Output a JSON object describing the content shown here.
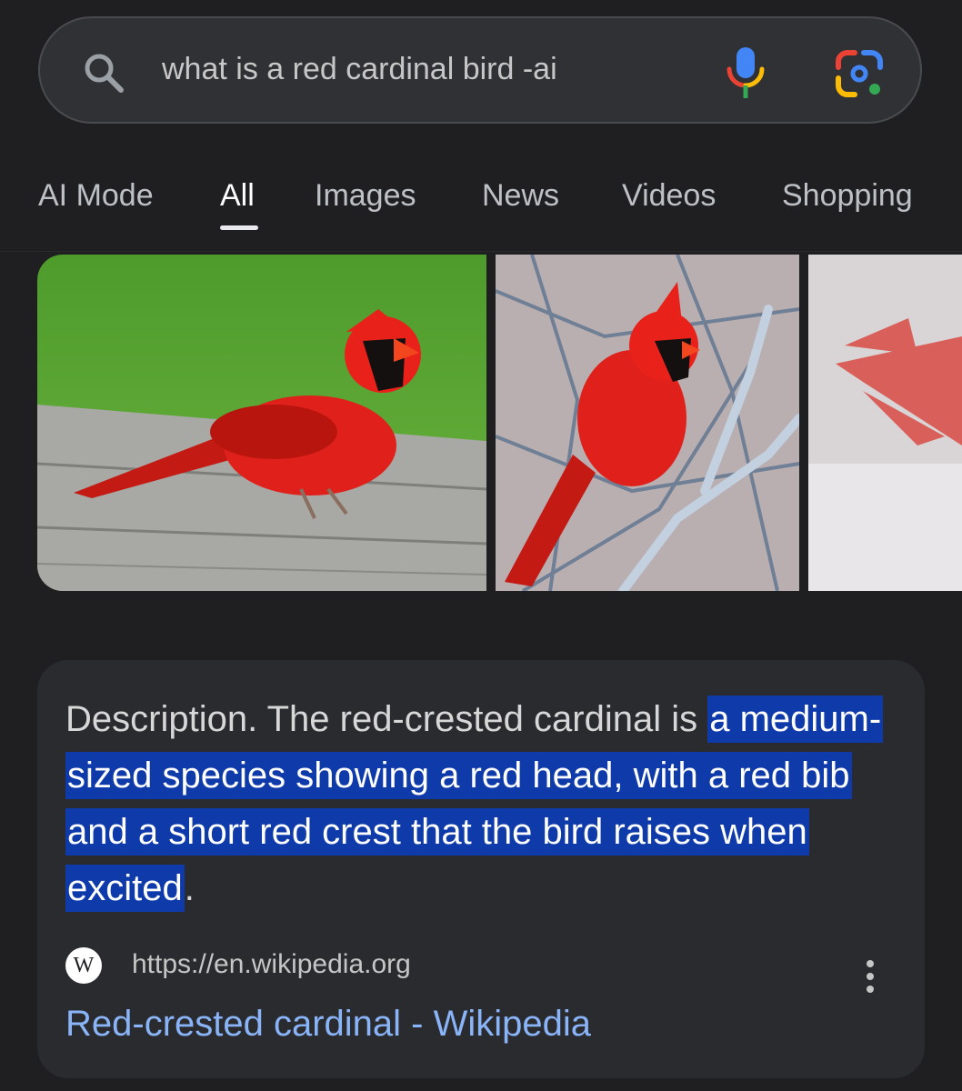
{
  "search": {
    "query": "what is a red cardinal bird -ai"
  },
  "tabs": [
    {
      "label": "AI Mode"
    },
    {
      "label": "All"
    },
    {
      "label": "Images"
    },
    {
      "label": "News"
    },
    {
      "label": "Videos"
    },
    {
      "label": "Shopping"
    }
  ],
  "active_tab": "All",
  "image_results": [
    {
      "subject": "red cardinal perched on wooden deck"
    },
    {
      "subject": "red cardinal perched on bare branches"
    },
    {
      "subject": "red cardinal in flight, partially visible"
    }
  ],
  "snippet": {
    "lead": "Description. The red-crested cardinal is ",
    "highlight": "a medium-sized species showing a red head, with a red bib and a short red crest that the bird raises when excited",
    "tail": "."
  },
  "result": {
    "site_letter": "W",
    "url": "https://en.wikipedia.org",
    "title": "Red-crested cardinal - Wikipedia"
  },
  "colors": {
    "background": "#1f1f21",
    "search_bg": "#303134",
    "card_bg": "#2a2b2f",
    "highlight": "#0f3aaa",
    "link": "#8ab4f8"
  }
}
